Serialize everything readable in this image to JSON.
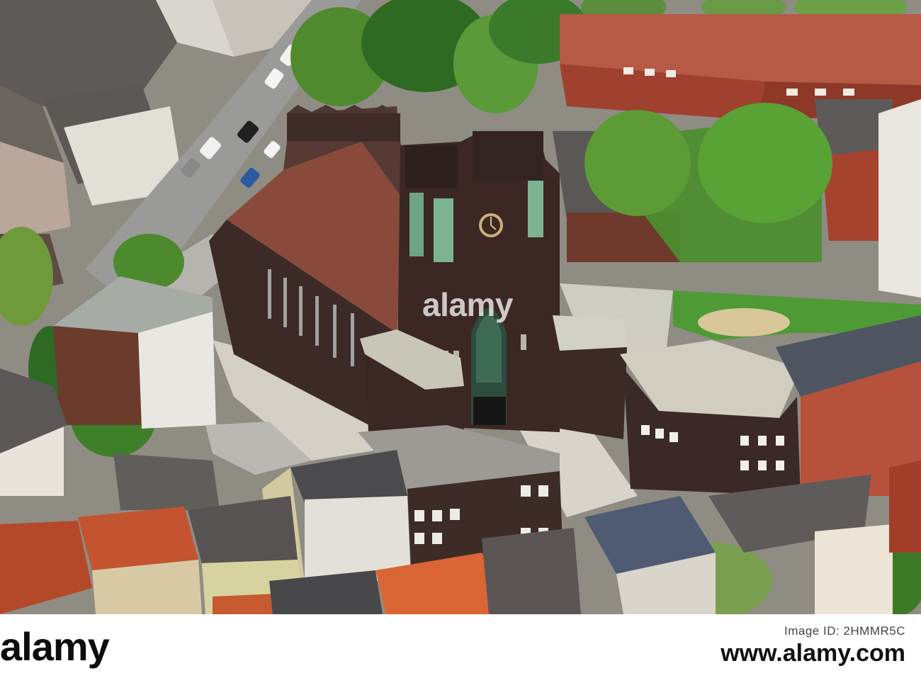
{
  "photo": {
    "subject": "aerial-view-church-with-clock-tower",
    "watermark": "alamy",
    "colors": {
      "brick": "#3e2b28",
      "roof": "#8a4a3b",
      "green": "#4f8a2e",
      "street": "#9a9a98"
    }
  },
  "footer": {
    "brand": "alamy",
    "image_id_label": "Image ID: 2HMMR5C",
    "site": "www.alamy.com"
  }
}
